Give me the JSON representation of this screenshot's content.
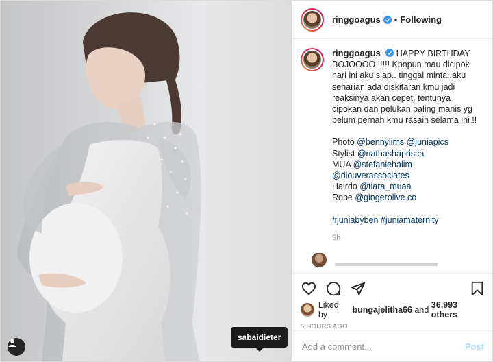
{
  "post": {
    "username": "ringgoagus",
    "follow_status": "Following",
    "separator": "•",
    "photo_tag": "sabaidieter"
  },
  "caption": {
    "username": "ringgoagus",
    "lines": [
      "HAPPY BIRTHDAY",
      "BOJOOOO !!!!! Kpnpun mau dicipok",
      "hari ini aku siap.. tinggal minta..aku",
      "seharian ada diskitaran kmu jadi",
      "reaksinya akan cepet, tentunya",
      "cipokan dan pelukan paling manis yg",
      "belum pernah kmu rasain selama ini !!"
    ],
    "credits": [
      {
        "label": "Photo",
        "tags": [
          "@bennylims",
          "@juniapics"
        ]
      },
      {
        "label": "Stylist",
        "tags": [
          "@nathashaprisca"
        ]
      },
      {
        "label": "MUA",
        "tags": [
          "@stefaniehalim"
        ]
      },
      {
        "label": "",
        "tags": [
          "@dlouverassociates"
        ]
      },
      {
        "label": "Hairdo",
        "tags": [
          "@tiara_muaa"
        ]
      },
      {
        "label": "Robe",
        "tags": [
          "@gingerolive.co"
        ]
      }
    ],
    "hashtags": "#juniabyben #juniamaternity",
    "age": "5h"
  },
  "likes": {
    "prefix": "Liked by",
    "liker": "bungajelitha66",
    "middle": "and",
    "others": "36,993 others"
  },
  "timestamp": "5 HOURS AGO",
  "comment": {
    "placeholder": "Add a comment...",
    "post_label": "Post"
  },
  "colors": {
    "link": "#00376b",
    "verified": "#3897f0",
    "post_disabled": "#b2dffc",
    "muted": "#8e8e8e"
  },
  "icons": [
    "heart-icon",
    "comment-icon",
    "share-icon",
    "bookmark-icon",
    "user-tag-icon",
    "verified-icon"
  ]
}
